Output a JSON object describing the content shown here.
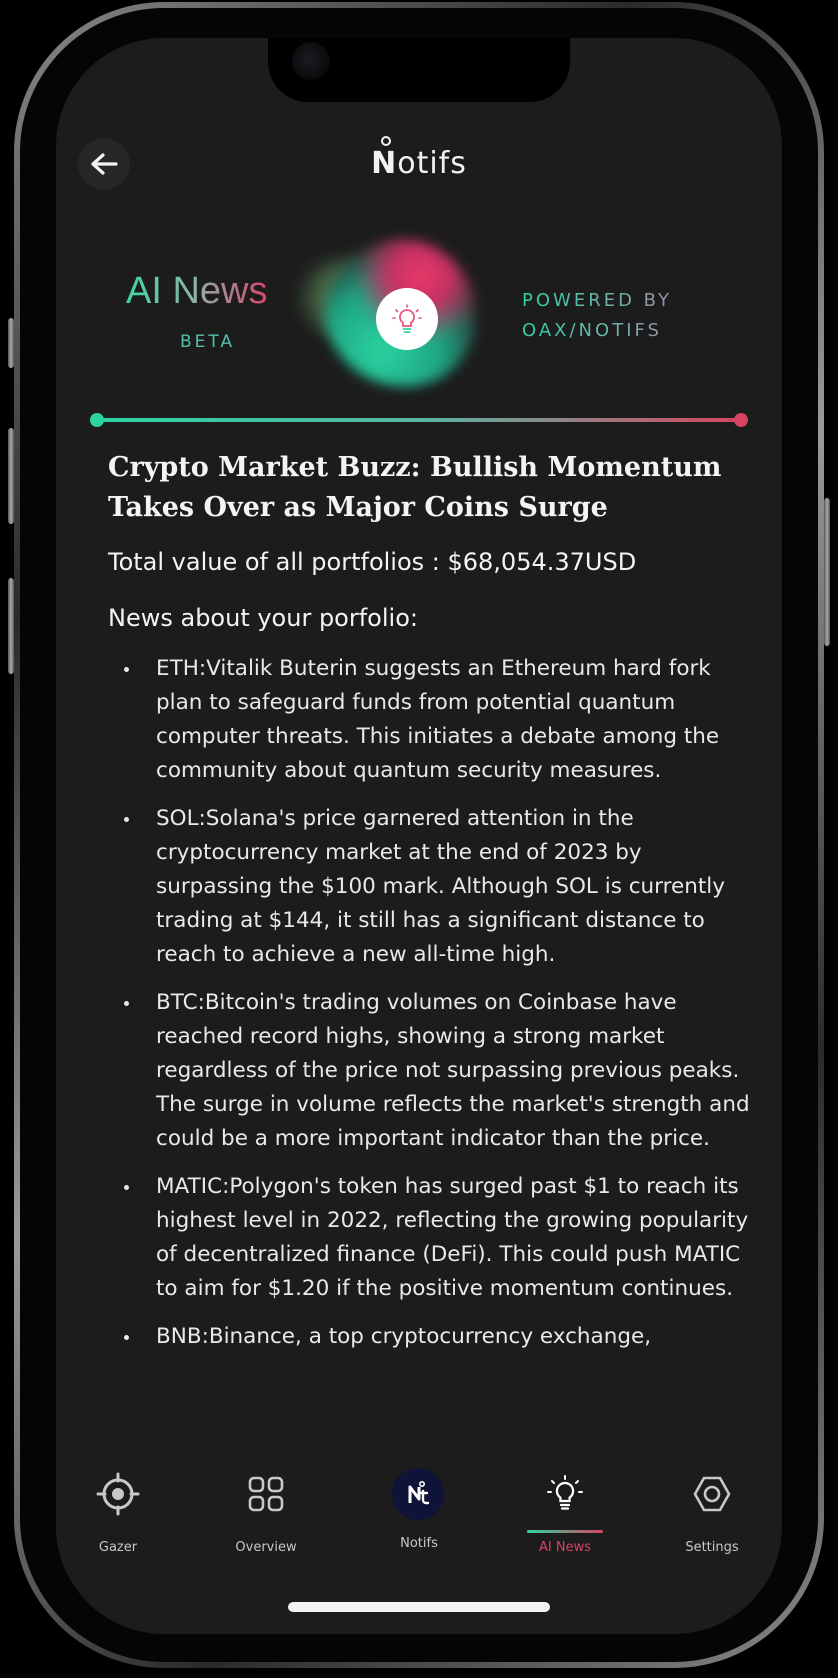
{
  "header": {
    "logo_text": "otifs",
    "logo_initial": "N"
  },
  "banner": {
    "title": "AI News",
    "badge": "BETA",
    "powered_line1": "POWERED BY",
    "powered_line2": "OAX/NOTIFS"
  },
  "article": {
    "headline": "Crypto Market Buzz: Bullish Momentum Takes Over as Major Coins Surge",
    "total_value": "Total value of all portfolios : $68,054.37USD",
    "news_label": "News about your porfolio:",
    "items": [
      "ETH:Vitalik Buterin suggests an Ethereum hard fork plan to safeguard funds from potential quantum computer threats. This initiates a debate among the community about quantum security measures.",
      "SOL:Solana's price garnered attention in the cryptocurrency market at the end of 2023 by surpassing the $100 mark. Although SOL is currently trading at $144, it still has a significant distance to reach to achieve a new all-time high.",
      "BTC:Bitcoin's trading volumes on Coinbase have reached record highs, showing a strong market regardless of the price not surpassing previous peaks. The surge in volume reflects the market's strength and could be a more important indicator than the price.",
      "MATIC:Polygon's token has surged past $1 to reach its highest level in 2022, reflecting the growing popularity of decentralized finance (DeFi). This could push MATIC to aim for $1.20 if the positive momentum continues.",
      "BNB:Binance, a top cryptocurrency exchange,"
    ]
  },
  "tabbar": {
    "tabs": [
      {
        "label": "Gazer",
        "icon": "target-icon",
        "active": false
      },
      {
        "label": "Overview",
        "icon": "grid-icon",
        "active": false
      },
      {
        "label": "Notifs",
        "icon": "notifs-logo-icon",
        "active": false
      },
      {
        "label": "AI News",
        "icon": "lightbulb-icon",
        "active": true
      },
      {
        "label": "Settings",
        "icon": "hexagon-icon",
        "active": false
      }
    ]
  },
  "colors": {
    "accent_green": "#2bd4a0",
    "accent_red": "#d6445f",
    "background": "#1c1c1c",
    "active_tab_label": "#d6445f"
  }
}
